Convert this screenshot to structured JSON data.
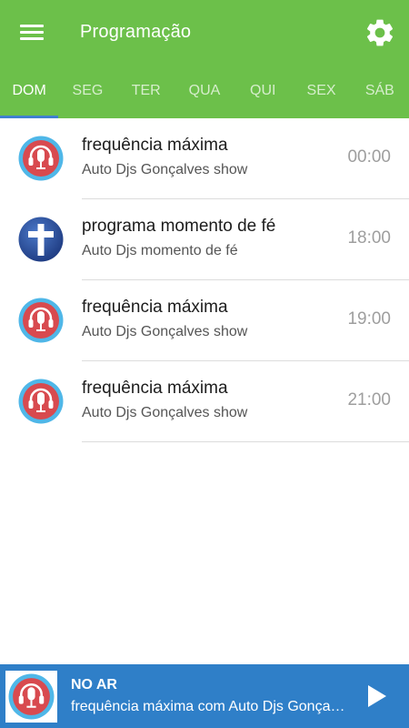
{
  "header": {
    "title": "Programação",
    "menu_icon": "hamburger-menu-icon",
    "settings_icon": "gear-icon"
  },
  "tabs": [
    {
      "label": "DOM",
      "active": true
    },
    {
      "label": "SEG",
      "active": false
    },
    {
      "label": "TER",
      "active": false
    },
    {
      "label": "QUA",
      "active": false
    },
    {
      "label": "QUI",
      "active": false
    },
    {
      "label": "SEX",
      "active": false
    },
    {
      "label": "SÁB",
      "active": false
    }
  ],
  "schedule": [
    {
      "name": "frequência máxima",
      "host": "Auto Djs Gonçalves show",
      "time": "00:00",
      "icon": "microphone-headphones-icon"
    },
    {
      "name": "programa momento de fé",
      "host": "Auto Djs momento de fé",
      "time": "18:00",
      "icon": "cross-icon"
    },
    {
      "name": "frequência máxima",
      "host": "Auto Djs Gonçalves show",
      "time": "19:00",
      "icon": "microphone-headphones-icon"
    },
    {
      "name": "frequência máxima",
      "host": "Auto Djs Gonçalves show",
      "time": "21:00",
      "icon": "microphone-headphones-icon"
    }
  ],
  "player": {
    "label": "NO AR",
    "now_playing": "frequência máxima com Auto Djs Gonçalves show",
    "play_icon": "play-icon"
  },
  "colors": {
    "appbar": "#6cc04a",
    "tab_indicator": "#3f7fcf",
    "player_bar": "#2f7fc8",
    "mic_icon_red": "#d84a4f",
    "mic_icon_ring": "#4fb7e8",
    "cross_icon_blue": "#2b4fa0"
  }
}
